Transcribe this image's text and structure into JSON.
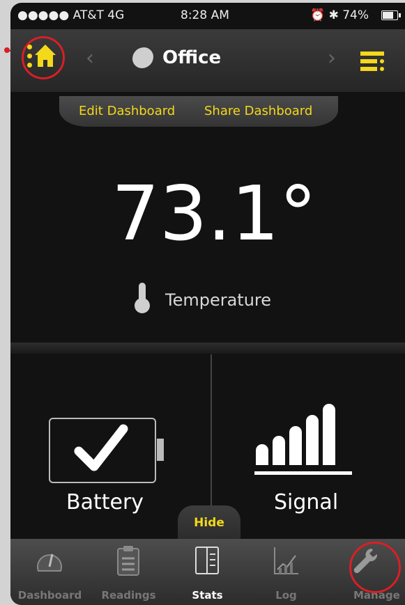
{
  "status_bar": {
    "carrier": "●●●●● AT&T  4G",
    "time": "8:28 AM",
    "indicators": "⏰ ✱ 74%"
  },
  "nav": {
    "home_icon": "home-icon",
    "prev_arrow": "‹",
    "next_arrow": "›",
    "location": "Office",
    "menu_icon": "menu-icon"
  },
  "dashboard_actions": {
    "edit": "Edit Dashboard",
    "share": "Share Dashboard"
  },
  "temperature": {
    "value": "73.1°",
    "label": "Temperature"
  },
  "battery": {
    "label": "Battery"
  },
  "signal": {
    "label": "Signal",
    "bars": 5
  },
  "hide_label": "Hide",
  "tabs": [
    {
      "label": "Dashboard",
      "icon": "gauge-icon"
    },
    {
      "label": "Readings",
      "icon": "clipboard-icon"
    },
    {
      "label": "Stats",
      "icon": "stats-icon"
    },
    {
      "label": "Log",
      "icon": "chart-icon"
    },
    {
      "label": "Manage",
      "icon": "wrench-icon"
    }
  ],
  "colors": {
    "accent": "#f4d81a",
    "highlight": "#d81f26",
    "background": "#121212"
  }
}
